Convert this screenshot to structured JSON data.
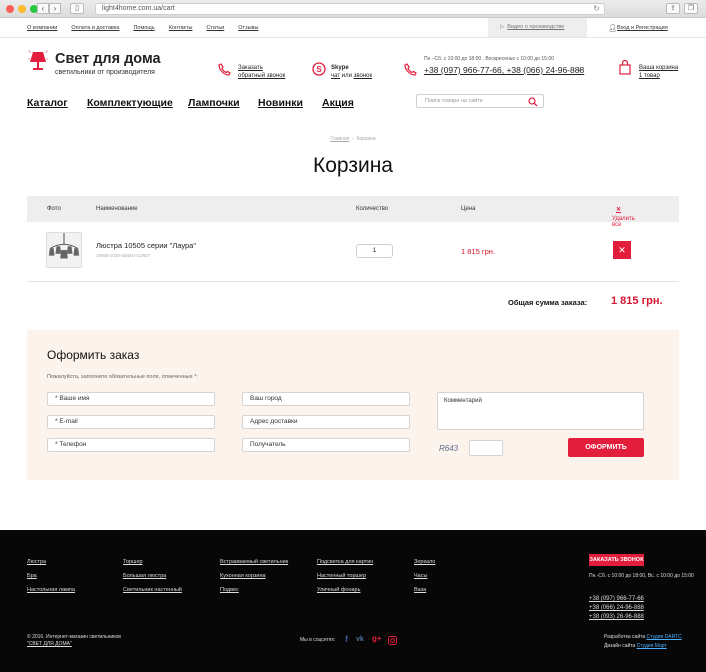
{
  "browser": {
    "url": "light4home.com.ua/cart"
  },
  "topbar": {
    "links": [
      "О компании",
      "Оплата и доставка",
      "Помощь",
      "Контакты",
      "Статьи",
      "Отзывы"
    ],
    "video": "Видео о производстве",
    "login": "Вход и Регистрация"
  },
  "header": {
    "brand": "Свет для дома",
    "tagline": "светильники от производителя",
    "callback_line1": "Заказать",
    "callback_line2": "обратный звонок",
    "skype_title": "Skype",
    "skype_chat": "чат",
    "skype_or": "или",
    "skype_call": "звонок",
    "hours": "Пн –Сб. с 10:00 до 18:00 , Воскресенье с 10:00 до 15:00",
    "phones": "+38 (097) 966-77-66, +38 (066) 24-96-888",
    "cart_title": "Ваша корзина",
    "cart_count": "1 товар"
  },
  "nav": {
    "items": [
      "Каталог",
      "Комплектующие",
      "Лампочки",
      "Новинки",
      "Акция"
    ],
    "search_placeholder": "Поиск товара на сайте"
  },
  "breadcrumb": {
    "home": "Главная",
    "sep": "›",
    "current": "Корзина"
  },
  "page_title": "Корзина",
  "cart": {
    "headers": {
      "photo": "Фото",
      "name": "Наименование",
      "qty": "Количество",
      "price": "Цена",
      "remove_all": "Удалить все"
    },
    "items": [
      {
        "name": "Люстра 10505 серии \"Лаура\"",
        "sku": "10505-c029-aba01t-t12807",
        "qty": "1",
        "price": "1 815 грн."
      }
    ],
    "total_label": "Общая сумма заказа:",
    "total_value": "1 815 грн."
  },
  "order": {
    "title": "Оформить заказ",
    "hint": "Пожалуйста, заполните обязательные поля, отмеченные *:",
    "name": "* Ваше имя",
    "email": "* E-mail",
    "phone": "* Телефон",
    "city": "Ваш город",
    "address": "Адрес доставки",
    "recipient": "Получатель",
    "comment": "Комментарий",
    "captcha": "R643",
    "submit": "ОФОРМИТЬ"
  },
  "footer": {
    "col1": [
      "Люстра",
      "Бра",
      "Настольная лампа"
    ],
    "col2": [
      "Торшер",
      "Большая люстра",
      "Светильник настенный"
    ],
    "col3": [
      "Встраиваемый светильник",
      "Кухонная корзина",
      "Подвес"
    ],
    "col4": [
      "Подсветка для картин",
      "Настенный торшер",
      "Уличный фонарь"
    ],
    "col5": [
      "Зеркало",
      "Часы",
      "Ваза"
    ],
    "call_button": "ЗАКАЗАТЬ ЗВОНОК",
    "hours": "Пн.-Сб. с 10:00 до 18:00, Вс. с 10:00 до 15:00",
    "phones": [
      "+38 (097) 966-77-66",
      "+38 (066) 24-96-888",
      "+38 (093) 26-96-888"
    ],
    "copyright_line1": "© 2016. Интернет-магазин светильников",
    "copyright_line2": "\"СВЕТ ДЛЯ ДОМА\"",
    "social_label": "Мы в соцсетях:",
    "dev_label": "Разработка сайта",
    "dev_link": "Студия DARTC",
    "design_label": "Дизайн сайта",
    "design_link": "Студия Март"
  },
  "colors": {
    "accent": "#e31e3c",
    "price": "#d3152f",
    "order_bg": "#fbf3ec",
    "footer_bg": "#070707"
  }
}
